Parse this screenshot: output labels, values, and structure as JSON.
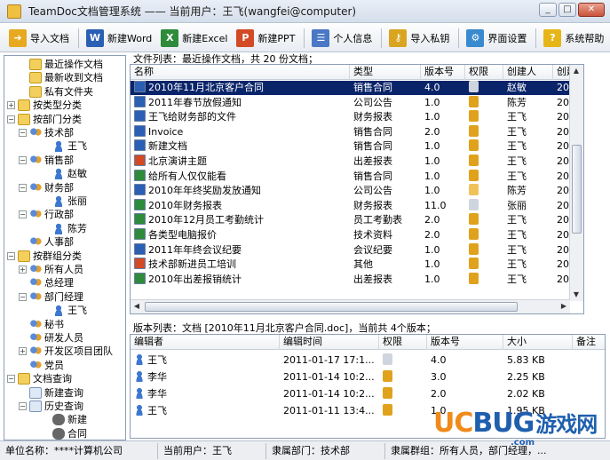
{
  "window": {
    "title": "TeamDoc文档管理系统 —— 当前用户：王飞(wangfei@computer)",
    "buttons": {
      "minimize": "_",
      "maximize": "□",
      "close": "✕"
    }
  },
  "toolbar": {
    "items": [
      {
        "label": "导入文档",
        "icon": "folder-import-icon",
        "color": "#e6a91f"
      },
      {
        "label": "新建Word",
        "icon": "word-icon",
        "color": "#2b5fb4"
      },
      {
        "label": "新建Excel",
        "icon": "excel-icon",
        "color": "#2e8b3a"
      },
      {
        "label": "新建PPT",
        "icon": "ppt-icon",
        "color": "#d24a26"
      },
      {
        "label": "个人信息",
        "icon": "person-info-icon",
        "color": "#4a78c4"
      },
      {
        "label": "导入私钥",
        "icon": "key-icon",
        "color": "#d9a520"
      },
      {
        "label": "界面设置",
        "icon": "settings-icon",
        "color": "#3a8ad0"
      },
      {
        "label": "系统帮助",
        "icon": "help-icon",
        "color": "#e6b619"
      }
    ]
  },
  "tree": {
    "nodes": [
      {
        "label": "最近操作文档",
        "depth": 1,
        "exp": "",
        "icon": "recent"
      },
      {
        "label": "最新收到文档",
        "depth": 1,
        "exp": "",
        "icon": "folder"
      },
      {
        "label": "私有文件夹",
        "depth": 1,
        "exp": "",
        "icon": "folder"
      },
      {
        "label": "按类型分类",
        "depth": 0,
        "exp": "+",
        "icon": "folder"
      },
      {
        "label": "按部门分类",
        "depth": 0,
        "exp": "−",
        "icon": "folder"
      },
      {
        "label": "技术部",
        "depth": 1,
        "exp": "−",
        "icon": "group"
      },
      {
        "label": "王飞",
        "depth": 3,
        "exp": "",
        "icon": "user"
      },
      {
        "label": "销售部",
        "depth": 1,
        "exp": "−",
        "icon": "group"
      },
      {
        "label": "赵敏",
        "depth": 3,
        "exp": "",
        "icon": "user"
      },
      {
        "label": "财务部",
        "depth": 1,
        "exp": "−",
        "icon": "group"
      },
      {
        "label": "张丽",
        "depth": 3,
        "exp": "",
        "icon": "user"
      },
      {
        "label": "行政部",
        "depth": 1,
        "exp": "−",
        "icon": "group"
      },
      {
        "label": "陈芳",
        "depth": 3,
        "exp": "",
        "icon": "user"
      },
      {
        "label": "人事部",
        "depth": 1,
        "exp": "",
        "icon": "group"
      },
      {
        "label": "按群组分类",
        "depth": 0,
        "exp": "−",
        "icon": "folder"
      },
      {
        "label": "所有人员",
        "depth": 1,
        "exp": "+",
        "icon": "group"
      },
      {
        "label": "总经理",
        "depth": 1,
        "exp": "",
        "icon": "group"
      },
      {
        "label": "部门经理",
        "depth": 1,
        "exp": "−",
        "icon": "group"
      },
      {
        "label": "王飞",
        "depth": 3,
        "exp": "",
        "icon": "user"
      },
      {
        "label": "秘书",
        "depth": 1,
        "exp": "",
        "icon": "group"
      },
      {
        "label": "研发人员",
        "depth": 1,
        "exp": "",
        "icon": "group"
      },
      {
        "label": "开发区项目团队",
        "depth": 1,
        "exp": "+",
        "icon": "group"
      },
      {
        "label": "党员",
        "depth": 1,
        "exp": "",
        "icon": "group"
      },
      {
        "label": "文档查询",
        "depth": 0,
        "exp": "−",
        "icon": "folder"
      },
      {
        "label": "新建查询",
        "depth": 1,
        "exp": "",
        "icon": "search"
      },
      {
        "label": "历史查询",
        "depth": 1,
        "exp": "−",
        "icon": "search"
      },
      {
        "label": "新建",
        "depth": 3,
        "exp": "",
        "icon": "binoc"
      },
      {
        "label": "合同",
        "depth": 3,
        "exp": "",
        "icon": "binoc"
      }
    ]
  },
  "doclist": {
    "caption": "文件列表：最近操作文档，共 20 份文档；",
    "columns": [
      "名称",
      "类型",
      "版本号",
      "权限",
      "创建人",
      "创建时"
    ],
    "rows": [
      {
        "name": "2010年11月北京客户合同",
        "type": "销售合同",
        "ver": "4.0",
        "perm": "edit",
        "creator": "赵敏",
        "time": "2011-",
        "doc": "word",
        "sel": true
      },
      {
        "name": "2011年春节放假通知",
        "type": "公司公告",
        "ver": "1.0",
        "perm": "lock-edit",
        "creator": "陈芳",
        "time": "2011-",
        "doc": "word"
      },
      {
        "name": "王飞给财务部的文件",
        "type": "财务报表",
        "ver": "1.0",
        "perm": "lock-edit",
        "creator": "王飞",
        "time": "2011-",
        "doc": "word"
      },
      {
        "name": "Invoice",
        "type": "销售合同",
        "ver": "2.0",
        "perm": "lock-edit",
        "creator": "王飞",
        "time": "2011-",
        "doc": "word"
      },
      {
        "name": "新建文档",
        "type": "销售合同",
        "ver": "1.0",
        "perm": "lock-edit",
        "creator": "王飞",
        "time": "2011-",
        "doc": "word"
      },
      {
        "name": "北京演讲主题",
        "type": "出差报表",
        "ver": "1.0",
        "perm": "lock",
        "creator": "王飞",
        "time": "2011-",
        "doc": "ppt"
      },
      {
        "name": "给所有人仅仅能看",
        "type": "销售合同",
        "ver": "1.0",
        "perm": "lock",
        "creator": "王飞",
        "time": "2011-",
        "doc": "excel"
      },
      {
        "name": "2010年年终奖励发放通知",
        "type": "公司公告",
        "ver": "1.0",
        "perm": "lock-open",
        "creator": "陈芳",
        "time": "2011-",
        "doc": "word"
      },
      {
        "name": "2010年财务报表",
        "type": "财务报表",
        "ver": "11.0",
        "perm": "edit",
        "creator": "张丽",
        "time": "2011-",
        "doc": "excel"
      },
      {
        "name": "2010年12月员工考勤统计",
        "type": "员工考勤表",
        "ver": "2.0",
        "perm": "lock-edit",
        "creator": "王飞",
        "time": "2011-",
        "doc": "excel"
      },
      {
        "name": "各类型电脑报价",
        "type": "技术资料",
        "ver": "2.0",
        "perm": "lock-edit",
        "creator": "王飞",
        "time": "2011-",
        "doc": "excel"
      },
      {
        "name": "2011年年终会议纪要",
        "type": "会议纪要",
        "ver": "1.0",
        "perm": "lock-edit",
        "creator": "王飞",
        "time": "2011-",
        "doc": "word"
      },
      {
        "name": "技术部新进员工培训",
        "type": "其他",
        "ver": "1.0",
        "perm": "lock-edit",
        "creator": "王飞",
        "time": "2011-",
        "doc": "ppt"
      },
      {
        "name": "2010年出差报销统计",
        "type": "出差报表",
        "ver": "1.0",
        "perm": "lock-edit",
        "creator": "王飞",
        "time": "2011-",
        "doc": "excel"
      }
    ]
  },
  "verlist": {
    "caption": "版本列表：文档 [2010年11月北京客户合同.doc]，当前共 4个版本；",
    "columns": [
      "编辑者",
      "编辑时间",
      "权限",
      "版本号",
      "大小",
      "备注"
    ],
    "rows": [
      {
        "editor": "王飞",
        "time": "2011-01-17 17:1...",
        "perm": "edit",
        "ver": "4.0",
        "size": "5.83 KB"
      },
      {
        "editor": "李华",
        "time": "2011-01-14 10:2...",
        "perm": "lock",
        "ver": "3.0",
        "size": "2.25 KB"
      },
      {
        "editor": "李华",
        "time": "2011-01-14 10:2...",
        "perm": "lock",
        "ver": "2.0",
        "size": "2.02 KB"
      },
      {
        "editor": "王飞",
        "time": "2011-01-11 13:4...",
        "perm": "lock",
        "ver": "1.0",
        "size": "1.95 KB"
      }
    ]
  },
  "statusbar": {
    "unit": "单位名称：****计算机公司",
    "user": "当前用户：王飞",
    "dept": "隶属部门：技术部",
    "groups": "隶属群组：所有人员，部门经理，..."
  },
  "watermark": {
    "uc": "UC",
    "bug": "BUG",
    "cn": "游戏网",
    "url": ".com"
  },
  "colors": {
    "selection": "#0a246a",
    "word": "#2b5fb4",
    "excel": "#2e8b3a",
    "ppt": "#d24a26",
    "lock": "#e0a21c"
  }
}
